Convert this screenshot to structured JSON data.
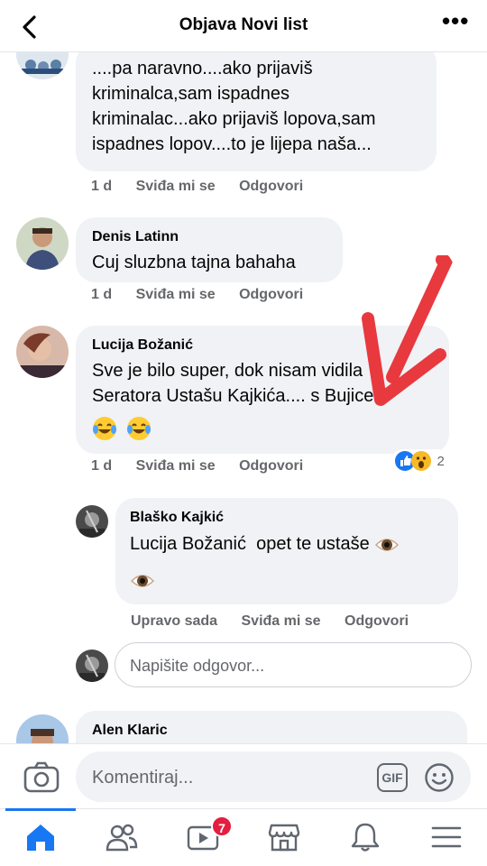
{
  "header": {
    "title": "Objava Novi list"
  },
  "comments": [
    {
      "text_lines": [
        "....pa naravno....ako prijaviš",
        "kriminalca,sam ispadnes",
        "kriminalac...ako prijaviš lopova,sam",
        "ispadnes lopov....to je lijepa naša..."
      ],
      "time": "1 d",
      "like_label": "Sviđa mi se",
      "reply_label": "Odgovori"
    },
    {
      "author": "Denis Latinn",
      "text_lines": [
        "Cuj sluzbna tajna bahaha"
      ],
      "time": "1 d",
      "like_label": "Sviđa mi se",
      "reply_label": "Odgovori"
    },
    {
      "author": "Lucija Božanić",
      "text_lines": [
        "Sve je bilo super, dok nisam vidila",
        "Seratora Ustašu Kajkića.... s Bujice..."
      ],
      "emojis": [
        "laughing-tears",
        "laughing-tears"
      ],
      "reactions": {
        "count": "2",
        "types": [
          "like",
          "wow"
        ]
      },
      "time": "1 d",
      "like_label": "Sviđa mi se",
      "reply_label": "Odgovori",
      "replies": [
        {
          "author": "Blaško Kajkić",
          "text_lines": [
            "Lucija Božanić  opet te ustaše"
          ],
          "emojis": [
            "eye",
            "eye"
          ],
          "time": "Upravo sada",
          "like_label": "Sviđa mi se",
          "reply_label": "Odgovori"
        }
      ]
    },
    {
      "author": "Alen Klaric"
    }
  ],
  "reply_input": {
    "placeholder": "Napišite odgovor..."
  },
  "composer": {
    "placeholder": "Komentiraj...",
    "gif_label": "GIF"
  },
  "tabbar": {
    "items": [
      "home",
      "friends",
      "watch",
      "marketplace",
      "notifications",
      "menu"
    ],
    "watch_badge": "7"
  },
  "colors": {
    "accent": "#1877f2",
    "bubble": "#f0f2f5",
    "meta": "#65676b",
    "annotation_arrow": "#e8393f"
  }
}
